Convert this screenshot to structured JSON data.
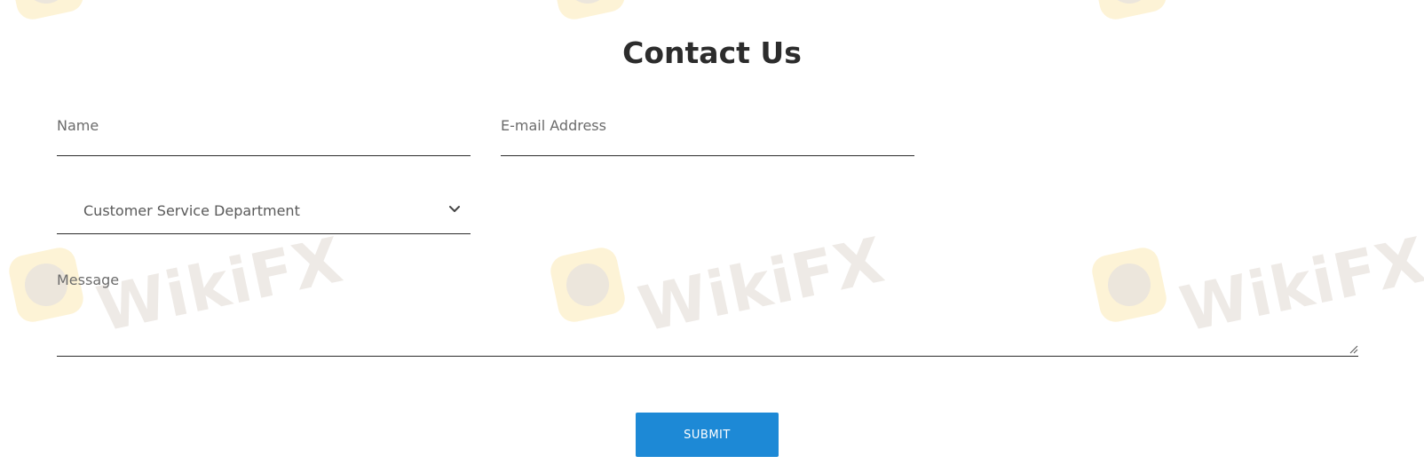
{
  "page": {
    "title": "Contact Us"
  },
  "form": {
    "name_placeholder": "Name",
    "email_placeholder": "E-mail Address",
    "department_value": "Customer Service Department",
    "message_placeholder": "Message",
    "submit_label": "SUBMIT"
  },
  "icons": {
    "dropdown": "chevron-down-icon",
    "resize": "resize-grip-icon"
  },
  "watermark": {
    "text": "WikiFX"
  },
  "colors": {
    "accent": "#1d89d6",
    "title": "#2c2c2c",
    "underline": "#2b2b2b",
    "watermark_logo": "#fdf3d6",
    "watermark_text": "#eeeae6"
  }
}
